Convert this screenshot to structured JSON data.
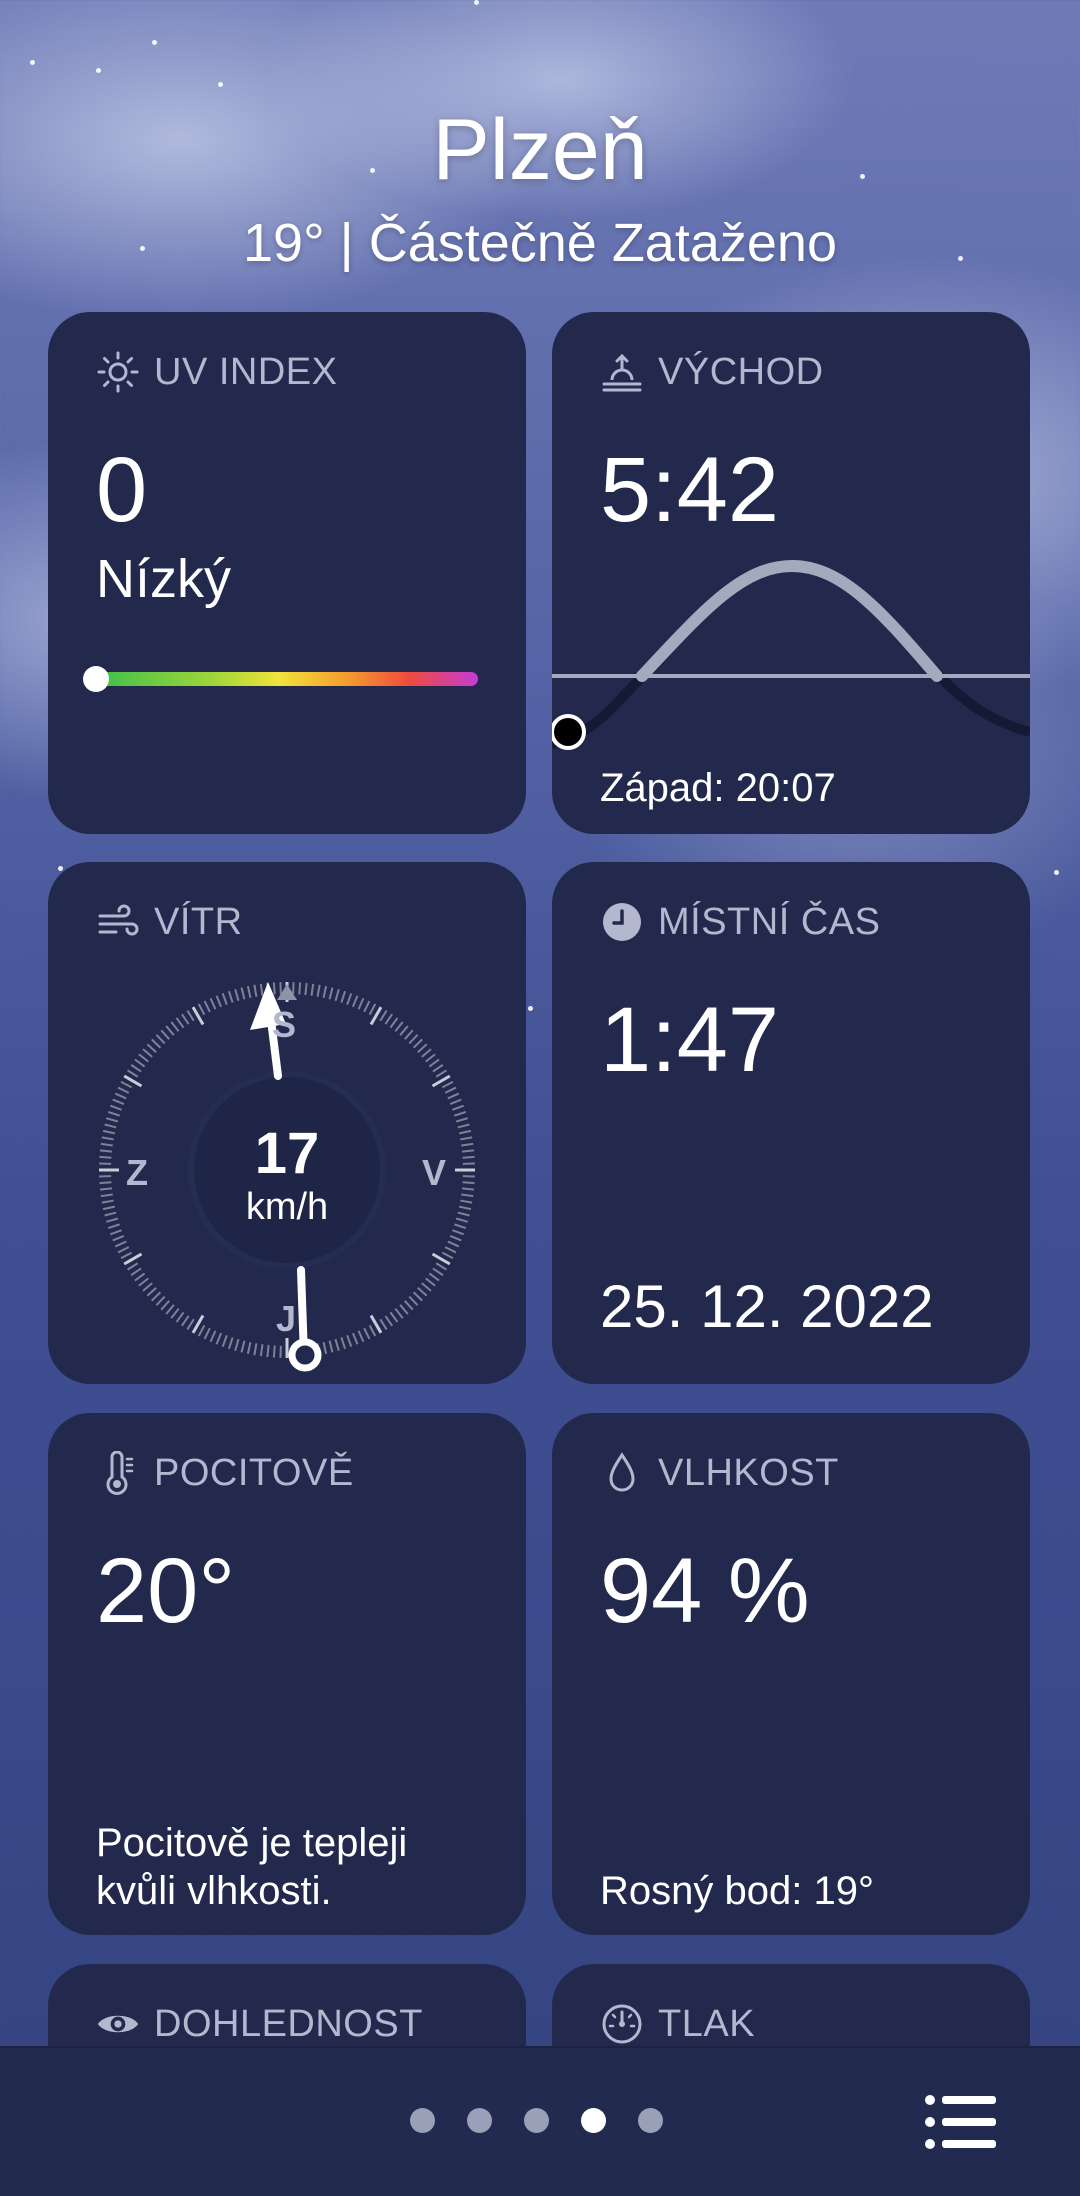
{
  "header": {
    "city": "Plzeň",
    "condition": "19° | Částečně Zataženo"
  },
  "uv": {
    "label": "UV INDEX",
    "value": "0",
    "level": "Nízký",
    "scale_position": 0.0,
    "icon": "sun-icon"
  },
  "sunrise": {
    "label": "VÝCHOD",
    "time": "5:42",
    "sunset_text": "Západ: 20:07",
    "icon": "sunrise-icon"
  },
  "wind": {
    "label": "VÍTR",
    "speed": "17",
    "unit": "km/h",
    "north": "S",
    "east": "V",
    "south": "J",
    "west": "Z",
    "icon": "wind-icon"
  },
  "local_time": {
    "label": "MÍSTNÍ ČAS",
    "time": "1:47",
    "date": "25. 12. 2022",
    "icon": "clock-icon"
  },
  "feels_like": {
    "label": "POCITOVĚ",
    "value": "20°",
    "note_line1": "Pocitově je tepleji",
    "note_line2": "kvůli vlhkosti.",
    "icon": "thermometer-icon"
  },
  "humidity": {
    "label": "VLHKOST",
    "value": "94 %",
    "dew_point": "Rosný bod: 19°",
    "icon": "droplet-icon"
  },
  "visibility": {
    "label": "DOHLEDNOST",
    "icon": "eye-icon"
  },
  "pressure": {
    "label": "TLAK",
    "icon": "gauge-icon"
  },
  "pager": {
    "count": 5,
    "active_index": 3
  },
  "colors": {
    "card_bg": "#22294d",
    "label_gray": "#b3b8cf",
    "bar_bg": "#232a50"
  }
}
